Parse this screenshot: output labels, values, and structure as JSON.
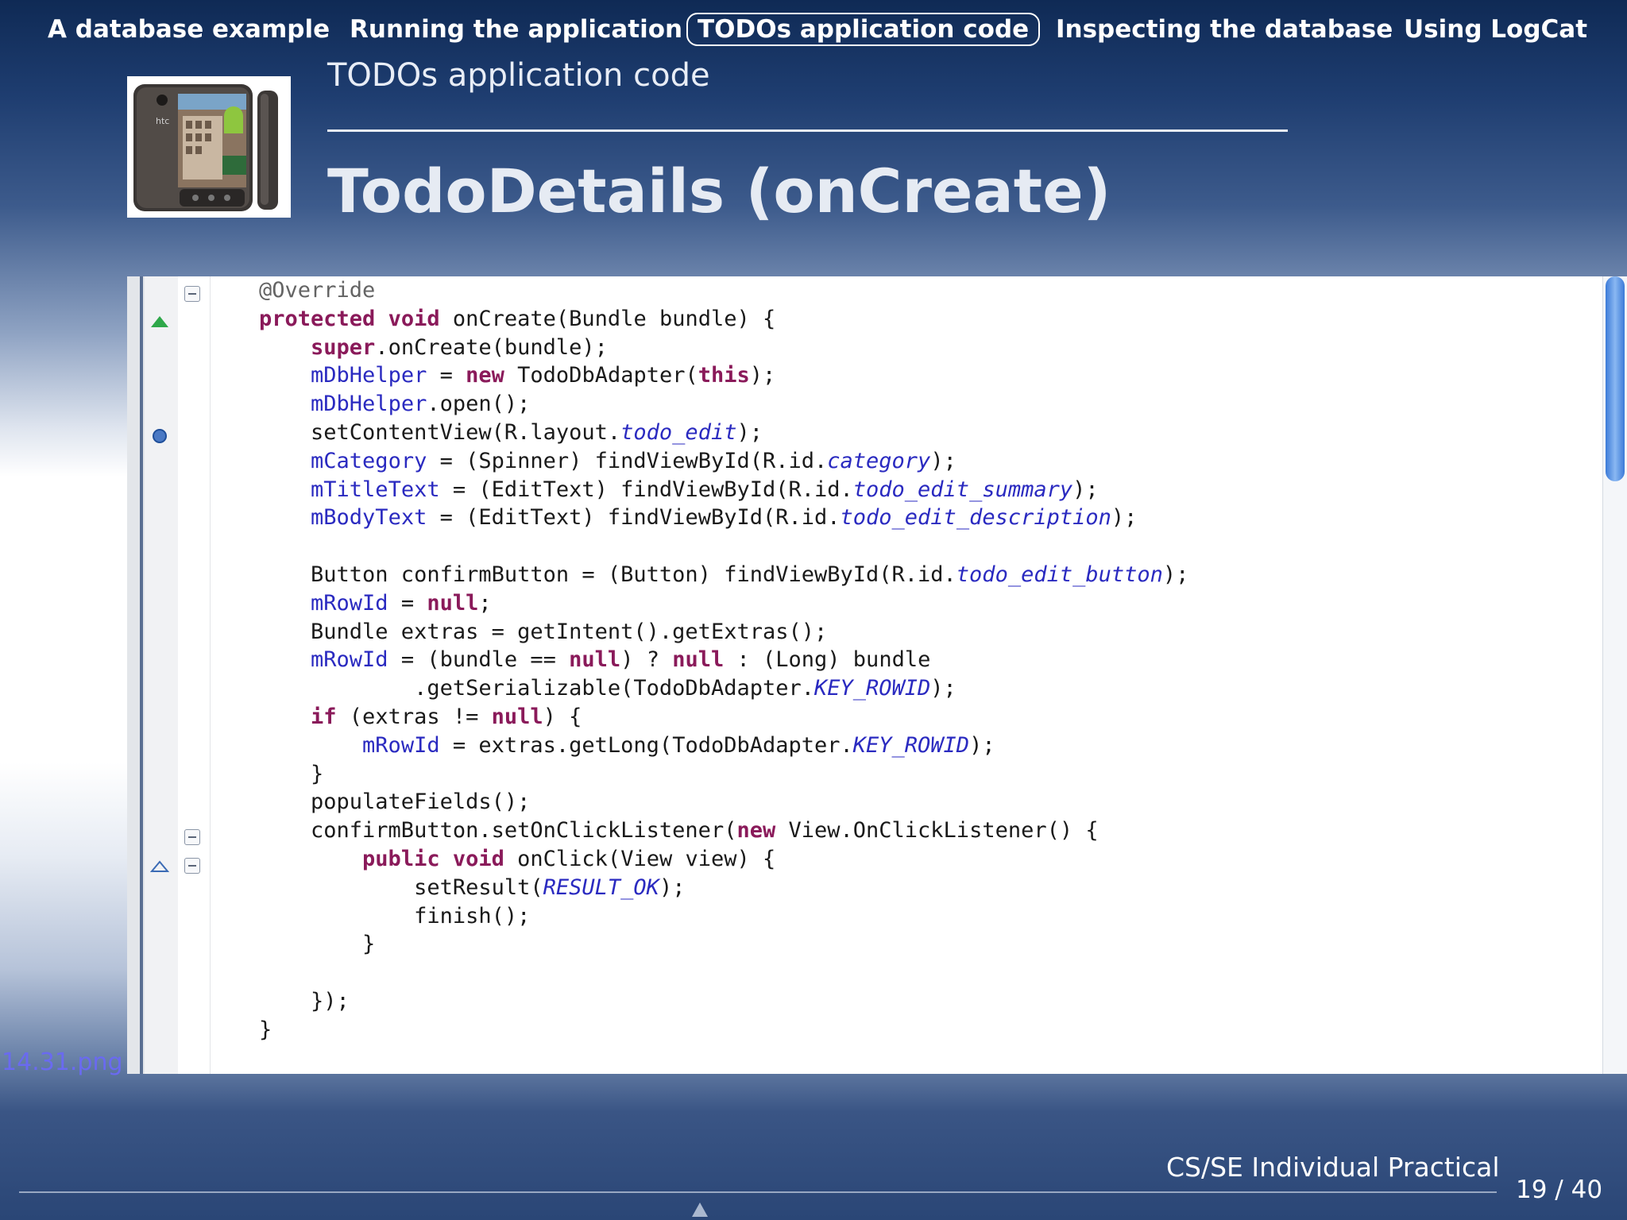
{
  "nav": {
    "items": [
      {
        "label": "A database example"
      },
      {
        "label": "Running the application"
      },
      {
        "label": "TODOs application code",
        "active": true
      },
      {
        "label": "Inspecting the database"
      },
      {
        "label": "Using LogCat"
      }
    ]
  },
  "header": {
    "section_title": "TODOs application code",
    "frame_title": "TodoDetails (onCreate)"
  },
  "code": {
    "lines": [
      "@Override",
      "protected void onCreate(Bundle bundle) {",
      "    super.onCreate(bundle);",
      "    mDbHelper = new TodoDbAdapter(this);",
      "    mDbHelper.open();",
      "    setContentView(R.layout.todo_edit);",
      "    mCategory = (Spinner) findViewById(R.id.category);",
      "    mTitleText = (EditText) findViewById(R.id.todo_edit_summary);",
      "    mBodyText = (EditText) findViewById(R.id.todo_edit_description);",
      "",
      "    Button confirmButton = (Button) findViewById(R.id.todo_edit_button);",
      "    mRowId = null;",
      "    Bundle extras = getIntent().getExtras();",
      "    mRowId = (bundle == null) ? null : (Long) bundle",
      "            .getSerializable(TodoDbAdapter.KEY_ROWID);",
      "    if (extras != null) {",
      "        mRowId = extras.getLong(TodoDbAdapter.KEY_ROWID);",
      "    }",
      "    populateFields();",
      "    confirmButton.setOnClickListener(new View.OnClickListener() {",
      "        public void onClick(View view) {",
      "            setResult(RESULT_OK);",
      "            finish();",
      "        }",
      "",
      "    });",
      "}"
    ],
    "image_caption": "14.31.png"
  },
  "footer": {
    "course": "CS/SE Individual Practical",
    "page": "19 / 40"
  },
  "colors": {
    "keyword": "#8a1a5a",
    "field": "#2a2ac0",
    "annotation": "#646464"
  },
  "icons": [
    "phone-logo-image",
    "fold-toggle-icon",
    "override-marker-icon",
    "breakpoint-icon",
    "implements-marker-icon",
    "nav-arrow-icon"
  ]
}
